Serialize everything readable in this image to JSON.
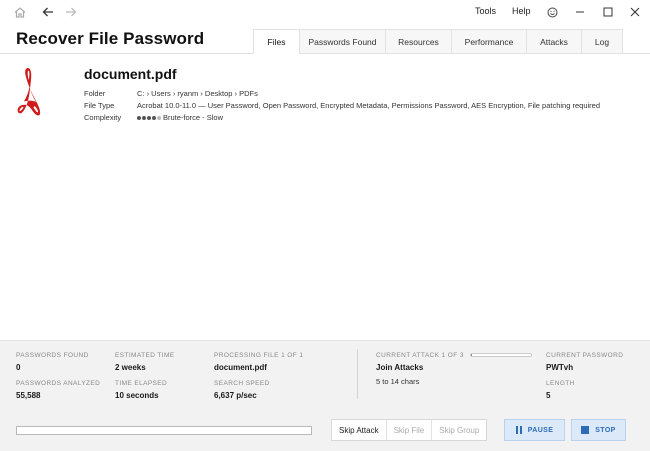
{
  "titlebar": {
    "menu": {
      "tools": "Tools",
      "help": "Help"
    },
    "icons": {
      "home": "home-icon",
      "back": "arrow-left-icon",
      "forward": "arrow-right-icon",
      "feedback": "smiley-icon",
      "minimize": "minimize-icon",
      "maximize": "maximize-icon",
      "close": "close-icon"
    }
  },
  "app": {
    "title": "Recover File Password"
  },
  "tabs": [
    {
      "label": "Files",
      "active": true
    },
    {
      "label": "Passwords Found",
      "active": false
    },
    {
      "label": "Resources",
      "active": false
    },
    {
      "label": "Performance",
      "active": false
    },
    {
      "label": "Attacks",
      "active": false
    },
    {
      "label": "Log",
      "active": false
    }
  ],
  "file": {
    "name": "document.pdf",
    "icon": "acrobat-pdf-icon",
    "folder_label": "Folder",
    "folder_value": "C: › Users › ryanm › Desktop › PDFs",
    "type_label": "File Type",
    "type_value": "Acrobat 10.0-11.0 — User Password, Open Password, Encrypted Metadata, Permissions Password, AES Encryption, File patching required",
    "complexity_label": "Complexity",
    "complexity_value": "Brute-force - Slow",
    "complexity_level": 4,
    "complexity_max": 5
  },
  "status": {
    "passwords_found_label": "Passwords Found",
    "passwords_found_value": "0",
    "estimated_time_label": "Estimated Time",
    "estimated_time_value": "2 weeks",
    "processing_file_label": "Processing File 1 of 1",
    "processing_file_value": "document.pdf",
    "passwords_analyzed_label": "Passwords Analyzed",
    "passwords_analyzed_value": "55,588",
    "time_elapsed_label": "Time Elapsed",
    "time_elapsed_value": "10 seconds",
    "search_speed_label": "Search Speed",
    "search_speed_value": "6,637 p/sec",
    "current_attack_label": "Current Attack 1 of 3",
    "current_attack_value": "Join Attacks",
    "current_attack_detail": "5 to 14 chars",
    "current_attack_progress": 0.02,
    "current_password_label": "Current Password",
    "current_password_value": "PWTvh",
    "length_label": "Length",
    "length_value": "5"
  },
  "controls": {
    "overall_progress": 0.0,
    "skip_attack": "Skip Attack",
    "skip_file": "Skip File",
    "skip_group": "Skip Group",
    "pause": "PAUSE",
    "stop": "STOP"
  }
}
